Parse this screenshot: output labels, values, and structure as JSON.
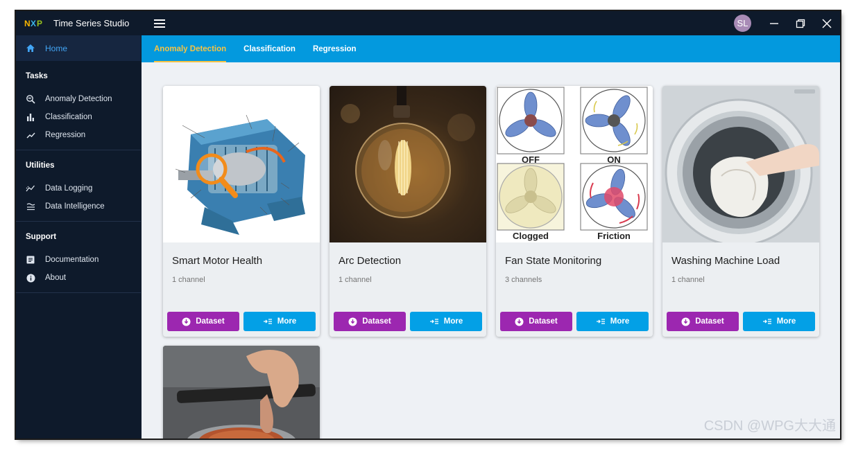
{
  "app": {
    "logo_letters": [
      "N",
      "X",
      "P"
    ],
    "title": "Time Series Studio",
    "avatar_initials": "SL"
  },
  "colors": {
    "accent": "#0399de",
    "active_tab": "#f6c344",
    "dataset_button": "#9c27b0",
    "more_button": "#03a0e6",
    "home_link": "#42a5f5"
  },
  "sidebar": {
    "home": {
      "label": "Home",
      "icon": "home-icon"
    },
    "sections": [
      {
        "title": "Tasks",
        "items": [
          {
            "label": "Anomaly Detection",
            "icon": "anomaly-search-icon"
          },
          {
            "label": "Classification",
            "icon": "bar-chart-icon"
          },
          {
            "label": "Regression",
            "icon": "trend-line-icon"
          }
        ]
      },
      {
        "title": "Utilities",
        "items": [
          {
            "label": "Data Logging",
            "icon": "data-logging-icon"
          },
          {
            "label": "Data Intelligence",
            "icon": "data-intelligence-icon"
          }
        ]
      },
      {
        "title": "Support",
        "items": [
          {
            "label": "Documentation",
            "icon": "document-icon"
          },
          {
            "label": "About",
            "icon": "info-icon"
          }
        ]
      }
    ]
  },
  "tabs": [
    {
      "label": "Anomaly Detection",
      "active": true
    },
    {
      "label": "Classification",
      "active": false
    },
    {
      "label": "Regression",
      "active": false
    }
  ],
  "cards": [
    {
      "title": "Smart Motor Health",
      "subtitle": "1 channel",
      "image": "motor-diagram"
    },
    {
      "title": "Arc Detection",
      "subtitle": "1 channel",
      "image": "light-bulb"
    },
    {
      "title": "Fan State Monitoring",
      "subtitle": "3 channels",
      "image": "fan-states",
      "fan_labels": [
        "OFF",
        "ON",
        "Clogged",
        "Friction"
      ]
    },
    {
      "title": "Washing Machine Load",
      "subtitle": "1 channel",
      "image": "washing-machine"
    },
    {
      "title": "",
      "subtitle": "",
      "image": "phone-wireless-charger"
    }
  ],
  "buttons": {
    "dataset_label": "Dataset",
    "more_label": "More"
  },
  "watermark": "CSDN @WPG大大通"
}
